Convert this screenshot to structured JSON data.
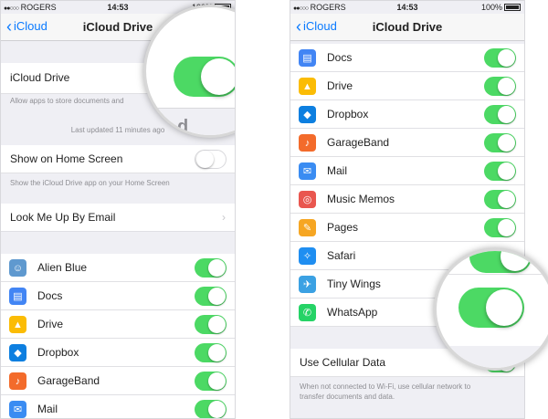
{
  "status": {
    "carrier": "ROGERS",
    "signal": "●●○○○",
    "time": "14:53",
    "battery_text": "100%"
  },
  "left": {
    "back_label": "iCloud",
    "title": "iCloud Drive",
    "icloud_row_label": "iCloud Drive",
    "icloud_note": "Allow apps to store documents and",
    "last_updated": "Last updated 11 minutes ago",
    "zoom_partial": "d",
    "home_screen_label": "Show on Home Screen",
    "home_screen_note": "Show the iCloud Drive app on your Home Screen",
    "look_me_up_label": "Look Me Up By Email",
    "apps": [
      {
        "name": "Alien Blue",
        "icon": "reddit-alien-icon",
        "color": "#5f99cf"
      },
      {
        "name": "Docs",
        "icon": "docs-icon",
        "color": "#4285f4"
      },
      {
        "name": "Drive",
        "icon": "drive-icon",
        "color": "#fbbc05"
      },
      {
        "name": "Dropbox",
        "icon": "dropbox-icon",
        "color": "#0d7fe0"
      },
      {
        "name": "GarageBand",
        "icon": "guitar-icon",
        "color": "#f36b2b"
      },
      {
        "name": "Mail",
        "icon": "envelope-icon",
        "color": "#3a8cf2"
      }
    ]
  },
  "right": {
    "back_label": "iCloud",
    "title": "iCloud Drive",
    "apps": [
      {
        "name": "Docs",
        "icon": "docs-icon",
        "color": "#4285f4"
      },
      {
        "name": "Drive",
        "icon": "drive-icon",
        "color": "#fbbc05"
      },
      {
        "name": "Dropbox",
        "icon": "dropbox-icon",
        "color": "#0d7fe0"
      },
      {
        "name": "GarageBand",
        "icon": "guitar-icon",
        "color": "#f36b2b"
      },
      {
        "name": "Mail",
        "icon": "envelope-icon",
        "color": "#3a8cf2"
      },
      {
        "name": "Music Memos",
        "icon": "music-memos-icon",
        "color": "#e9564f"
      },
      {
        "name": "Pages",
        "icon": "pages-icon",
        "color": "#f6a623"
      },
      {
        "name": "Safari",
        "icon": "compass-icon",
        "color": "#1f8ef1"
      },
      {
        "name": "Tiny Wings",
        "icon": "bird-icon",
        "color": "#3ba1e3"
      },
      {
        "name": "WhatsApp",
        "icon": "whatsapp-icon",
        "color": "#25d366"
      }
    ],
    "cellular_label": "Use Cellular Data",
    "cellular_note_1": "When not connected to Wi-Fi, use cellular network to",
    "cellular_note_2": "transfer documents and data."
  },
  "colors": {
    "toggle_on": "#4cd964",
    "link_blue": "#0a7aff",
    "group_bg": "#efeff4"
  }
}
